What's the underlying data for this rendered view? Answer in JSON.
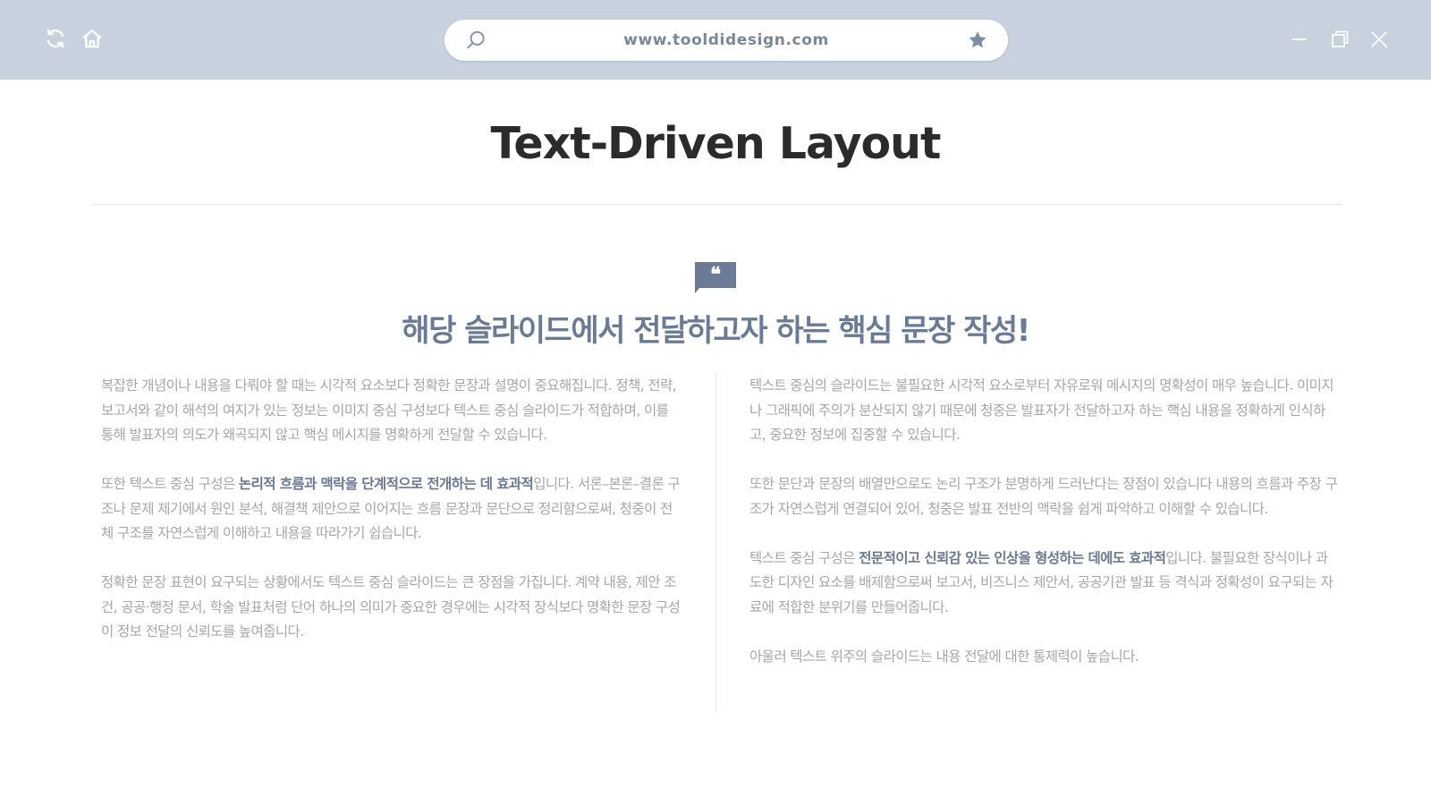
{
  "browser": {
    "url": "www.tooldidesign.com",
    "icons": {
      "reload": "reload-icon",
      "home": "home-icon",
      "search": "search-icon",
      "bookmark": "star-icon",
      "minimize": "minimize-icon",
      "maximize": "restore-icon",
      "close": "close-icon"
    },
    "colors": {
      "toolbar": "#c7d2de",
      "icon": "#ffffff",
      "url_text": "#7a8795",
      "star": "#7b8ea6"
    }
  },
  "page": {
    "title": "Text-Driven Layout",
    "headline": "해당 슬라이드에서 전달하고자 하는 핵심 문장 작성!",
    "quote_icon": "quote-icon",
    "colors": {
      "accent": "#6b7b95",
      "title": "#2b2b2b",
      "body": "#a6a6a6"
    },
    "left_column": [
      {
        "before": "복잡한 개념이나 내용을 다뤄야 할 때는 시각적 요소보다 정확한 문장과 설명이 중요해집니다. 정책, 전략, 보고서와 같이 해석의 여지가 있는 정보는 이미지 중심 구성보다 텍스트 중심 슬라이드가 적합하며, 이를 통해 발표자의 의도가 왜곡되지 않고 핵심 메시지를 명확하게 전달할 수 있습니다.",
        "strong": "",
        "after": ""
      },
      {
        "before": "또한 텍스트 중심 구성은 ",
        "strong": "논리적 흐름과 맥락을 단계적으로 전개하는 데 효과적",
        "after": "입니다. 서론–본론–결론 구조나 문제 제기에서 원인 분석, 해결책 제안으로 이어지는 흐름 문장과 문단으로 정리함으로써, 청중이 전체 구조를 자연스럽게 이해하고 내용을 따라가기 쉽습니다."
      },
      {
        "before": "정확한 문장 표현이 요구되는 상황에서도 텍스트 중심 슬라이드는 큰 장점을 가집니다. 계약 내용, 제안 조건, 공공·행정 문서, 학술 발표처럼 단어 하나의 의미가 중요한 경우에는 시각적 장식보다 명확한 문장 구성이 정보 전달의 신뢰도를 높여줍니다.",
        "strong": "",
        "after": ""
      }
    ],
    "right_column": [
      {
        "before": "텍스트 중심의 슬라이드는 불필요한 시각적 요소로부터 자유로워 메시지의 명확성이 매우 높습니다. 이미지나 그래픽에 주의가 분산되지 않기 때문에 청중은 발표자가 전달하고자 하는 핵심 내용을 정확하게 인식하고, 중요한 정보에 집중할 수 있습니다.",
        "strong": "",
        "after": ""
      },
      {
        "before": "또한 문단과 문장의 배열만으로도 논리 구조가 분명하게 드러난다는 장점이 있습니다 내용의 흐름과 주장 구조가 자연스럽게 연결되어 있어, 청중은 발표 전반의 맥락을 쉽게 파악하고 이해할 수 있습니다.",
        "strong": "",
        "after": ""
      },
      {
        "before": "텍스트 중심 구성은 ",
        "strong": "전문적이고 신뢰감 있는 인상을 형성하는 데에도 효과적",
        "after": "입니다. 불필요한 장식이나 과도한 디자인 요소를 배제함으로써 보고서, 비즈니스 제안서, 공공기관 발표 등 격식과 정확성이 요구되는 자료에 적합한 분위기를 만들어줍니다."
      },
      {
        "before": "아울러 텍스트 위주의 슬라이드는 내용 전달에 대한 통제력이 높습니다.",
        "strong": "",
        "after": ""
      }
    ]
  }
}
